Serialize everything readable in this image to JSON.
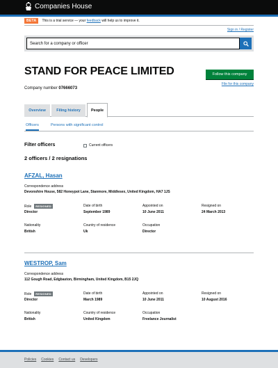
{
  "header": {
    "logo_text": "Companies House"
  },
  "phase_banner": {
    "tag": "BETA",
    "text_before": "This is a trial service — your",
    "link": "feedback",
    "text_after": "will help us to improve it."
  },
  "sign_in_link": "Sign in / Register",
  "search": {
    "placeholder": "Search for a company or officer"
  },
  "company": {
    "name": "STAND FOR PEACE LIMITED",
    "number_label": "Company number",
    "number": "07666073",
    "follow_button": "Follow this company",
    "file_link": "File for this company"
  },
  "tabs": [
    {
      "label": "Overview",
      "active": false
    },
    {
      "label": "Filing history",
      "active": false
    },
    {
      "label": "People",
      "active": true
    }
  ],
  "subnav": [
    {
      "label": "Officers",
      "active": true
    },
    {
      "label": "Persons with significant control",
      "active": false
    }
  ],
  "filter": {
    "title": "Filter officers",
    "checkbox_label": "Current officers"
  },
  "counts": "2 officers / 2 resignations",
  "labels": {
    "address": "Correspondence address",
    "role": "Role",
    "dob": "Date of birth",
    "appointed": "Appointed on",
    "resigned": "Resigned on",
    "nationality": "Nationality",
    "residence": "Country of residence",
    "occupation": "Occupation",
    "resigned_tag": "RESIGNED"
  },
  "officers": [
    {
      "name": "AFZAL, Hasan",
      "address": "Devonshire House, 582 Honeypot Lane, Stanmore, Middlesex, United Kingdom, HA7 1JS",
      "role": "Director",
      "dob": "September 1989",
      "appointed": "10 June 2011",
      "resigned": "24 March 2013",
      "nationality": "British",
      "residence": "Uk",
      "occupation": "Director"
    },
    {
      "name": "WESTROP, Sam",
      "address": "112 Gough Road, Edgbaston, Birmingham, United Kingdom, B15 2JQ",
      "role": "Director",
      "dob": "March 1989",
      "appointed": "10 June 2011",
      "resigned": "10 August 2016",
      "nationality": "British",
      "residence": "United Kingdom",
      "occupation": "Freelance Journalist"
    }
  ],
  "footer": {
    "links": [
      "Policies",
      "Cookies",
      "Contact us",
      "Developers"
    ]
  },
  "colors": {
    "header": "#0b0c0c",
    "link": "#1d70b8",
    "follow_button": "#00823b",
    "beta_tag": "#f47738",
    "resigned_tag": "#6f777b"
  }
}
